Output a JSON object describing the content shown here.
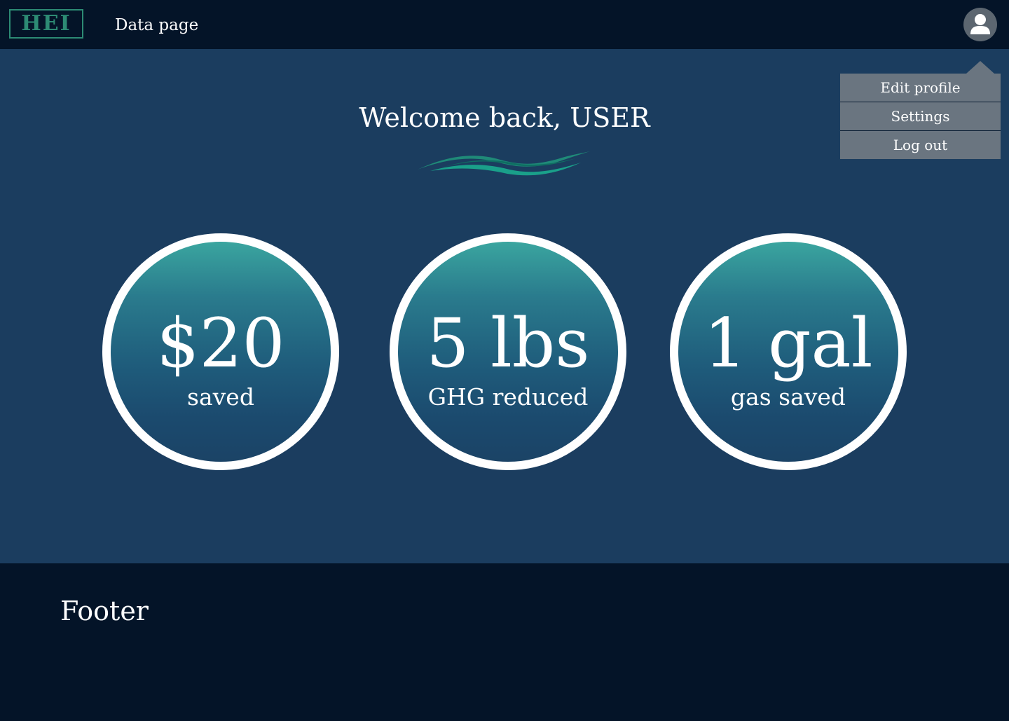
{
  "header": {
    "logo_text": "HEI",
    "page_label": "Data page",
    "avatar_icon": "user-avatar-icon"
  },
  "main": {
    "welcome": "Welcome back, USER",
    "stats": [
      {
        "value": "$20",
        "label": "saved"
      },
      {
        "value": "5 lbs",
        "label": "GHG reduced"
      },
      {
        "value": "1 gal",
        "label": "gas saved"
      }
    ]
  },
  "user_menu": {
    "items": [
      {
        "label": "Edit profile"
      },
      {
        "label": "Settings"
      },
      {
        "label": "Log out"
      }
    ]
  },
  "footer": {
    "title": "Footer"
  },
  "colors": {
    "header_bg": "#041428",
    "main_bg": "#1b3d5f",
    "accent_teal": "#2d8b74",
    "circle_top": "#3aa59f",
    "circle_bottom": "#1b4366",
    "menu_bg": "#6a7580"
  }
}
